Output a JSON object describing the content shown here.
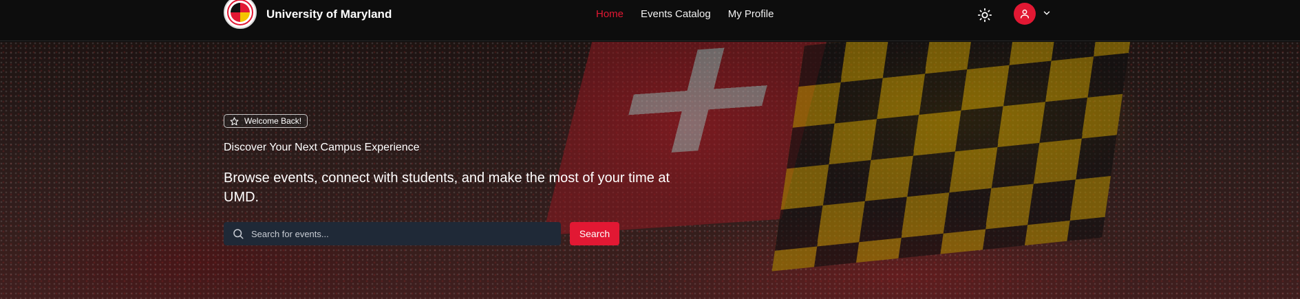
{
  "header": {
    "brand_name": "University of Maryland",
    "nav": [
      {
        "label": "Home",
        "active": true
      },
      {
        "label": "Events Catalog",
        "active": false
      },
      {
        "label": "My Profile",
        "active": false
      }
    ],
    "theme_icon": "sun-icon",
    "avatar_icon": "user-icon",
    "menu_icon": "chevron-down-icon"
  },
  "hero": {
    "badge_icon": "star-icon",
    "badge_label": "Welcome Back!",
    "tagline": "Discover Your Next Campus Experience",
    "headline": "Browse events, connect with students, and make the most of your time at UMD.",
    "search": {
      "icon": "search-icon",
      "placeholder": "Search for events...",
      "value": "",
      "button_label": "Search"
    }
  },
  "colors": {
    "accent": "#e21833",
    "header_bg": "#0d0d0d",
    "search_bg": "#1f2937"
  }
}
